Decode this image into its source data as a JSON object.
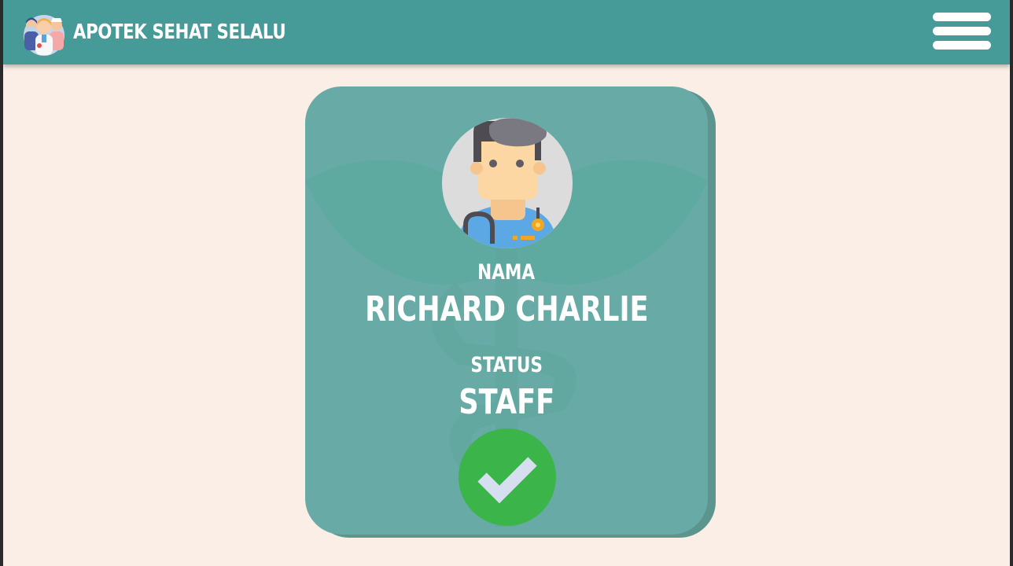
{
  "header": {
    "brand": "APOTEK SEHAT SELALU",
    "logo_icon": "medical-team-icon",
    "menu_icon": "hamburger-menu-icon"
  },
  "profile": {
    "name_label": "NAMA",
    "name": "RICHARD CHARLIE",
    "status_label": "STATUS",
    "status": "STAFF",
    "avatar_icon": "doctor-avatar-icon",
    "verified_icon": "check-circle-icon"
  },
  "colors": {
    "navbar": "#469a98",
    "background": "#fbeee6",
    "card": "#68aba6",
    "card_shadow": "#5b958e",
    "verified": "#3bb54a",
    "text": "#ffffff"
  }
}
